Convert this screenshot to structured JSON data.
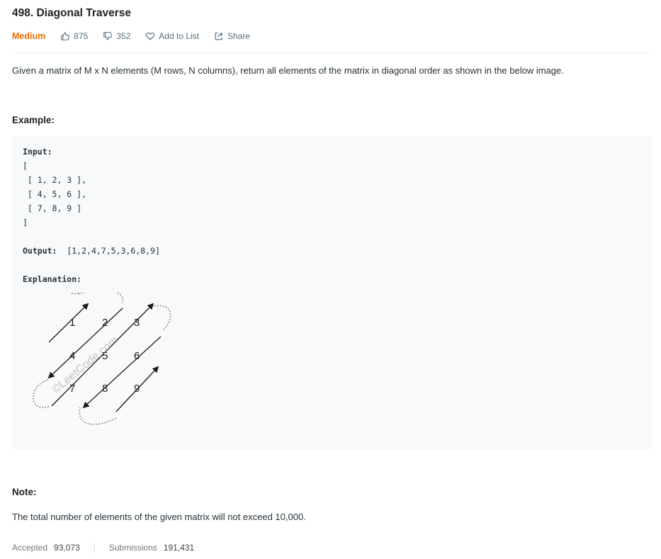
{
  "problem": {
    "title": "498. Diagonal Traverse",
    "difficulty": "Medium",
    "likes": "875",
    "dislikes": "352",
    "add_to_list_label": "Add to List",
    "share_label": "Share"
  },
  "description": "Given a matrix of M x N elements (M rows, N columns), return all elements of the matrix in diagonal order as shown in the below image.",
  "example": {
    "heading": "Example:",
    "input_label": "Input:",
    "input_lines": [
      "[",
      " [ 1, 2, 3 ],",
      " [ 4, 5, 6 ],",
      " [ 7, 8, 9 ]",
      "]"
    ],
    "output_label": "Output:",
    "output_value": "[1,2,4,7,5,3,6,8,9]",
    "explanation_label": "Explanation:",
    "diagram": {
      "numbers": [
        "1",
        "2",
        "3",
        "4",
        "5",
        "6",
        "7",
        "8",
        "9"
      ],
      "watermark": "©LeetCode.com"
    }
  },
  "note": {
    "heading": "Note:",
    "text": "The total number of elements of the given matrix will not exceed 10,000."
  },
  "stats": {
    "accepted_label": "Accepted",
    "accepted_value": "93,073",
    "submissions_label": "Submissions",
    "submissions_value": "191,431"
  },
  "colors": {
    "difficulty_medium": "#ef6c00",
    "text": "#263238",
    "muted": "#546e7a",
    "example_bg": "#f7f9fa"
  }
}
